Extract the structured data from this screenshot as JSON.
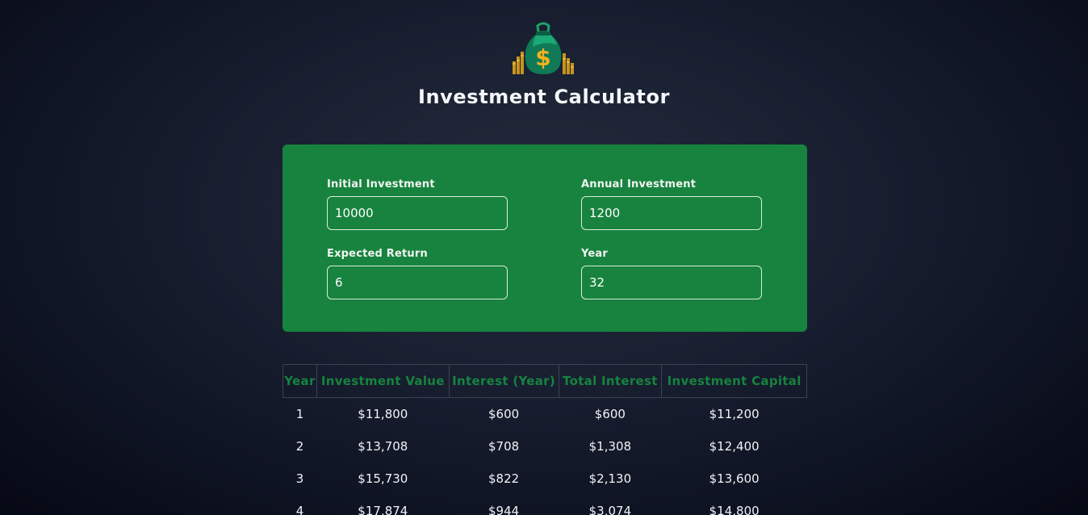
{
  "header": {
    "logo_icon": "money-bag-icon",
    "title": "Investment Calculator"
  },
  "inputs": {
    "initial_investment": {
      "label": "Initial Investment",
      "value": "10000"
    },
    "annual_investment": {
      "label": "Annual Investment",
      "value": "1200"
    },
    "expected_return": {
      "label": "Expected Return",
      "value": "6"
    },
    "duration": {
      "label": "Year",
      "value": "32"
    }
  },
  "table": {
    "headers": [
      "Year",
      "Investment Value",
      "Interest (Year)",
      "Total Interest",
      "Investment Capital"
    ],
    "rows": [
      [
        "1",
        "$11,800",
        "$600",
        "$600",
        "$11,200"
      ],
      [
        "2",
        "$13,708",
        "$708",
        "$1,308",
        "$12,400"
      ],
      [
        "3",
        "$15,730",
        "$822",
        "$2,130",
        "$13,600"
      ],
      [
        "4",
        "$17,874",
        "$944",
        "$3,074",
        "$14,800"
      ]
    ]
  },
  "colors": {
    "accent_green": "#17833f",
    "background": "#1a2132",
    "text": "#ffffff"
  }
}
